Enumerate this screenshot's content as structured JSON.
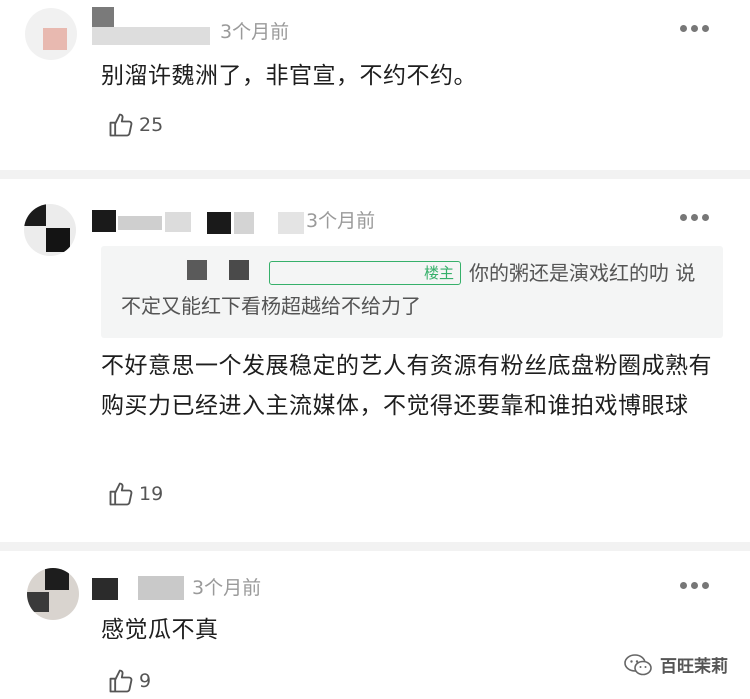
{
  "comments": [
    {
      "time": "3个月前",
      "text": "别溜许魏洲了，非官宣，不约不约。",
      "likes": "25"
    },
    {
      "time": "3个月前",
      "reply_quote": {
        "tag": "楼主",
        "text": "你的粥还是演戏红的叻 说不定又能红下看杨超越给不给力了"
      },
      "text": "不好意思一个发展稳定的艺人有资源有粉丝底盘粉圈成熟有购买力已经进入主流媒体，不觉得还要靠和谁拍戏博眼球",
      "likes": "19"
    },
    {
      "time": "3个月前",
      "text": "感觉瓜不真",
      "likes": "9"
    }
  ],
  "icons": {
    "like": "thumbs-up-icon",
    "more": "more-options-icon",
    "watermark": "wechat-icon"
  },
  "watermark": {
    "text": "百旺茉莉"
  }
}
